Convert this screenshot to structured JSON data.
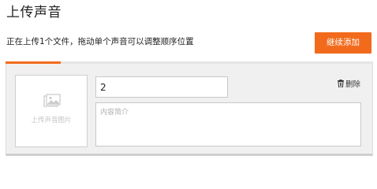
{
  "header": {
    "title": "上传声音",
    "subtitle": "正在上传1个文件，拖动单个声音可以调整顺序位置",
    "add_button_label": "继续添加"
  },
  "upload_progress": {
    "percent": 15,
    "color": "#f26b1d"
  },
  "item": {
    "cover_label": "上传声音图片",
    "cover_icon": "image-icon",
    "title_value": "2",
    "description_placeholder": "内容简介",
    "description_value": "",
    "delete_label": "删除",
    "delete_icon": "trash-icon"
  },
  "colors": {
    "accent": "#f26b1d",
    "card_background": "#f0f0f0"
  }
}
